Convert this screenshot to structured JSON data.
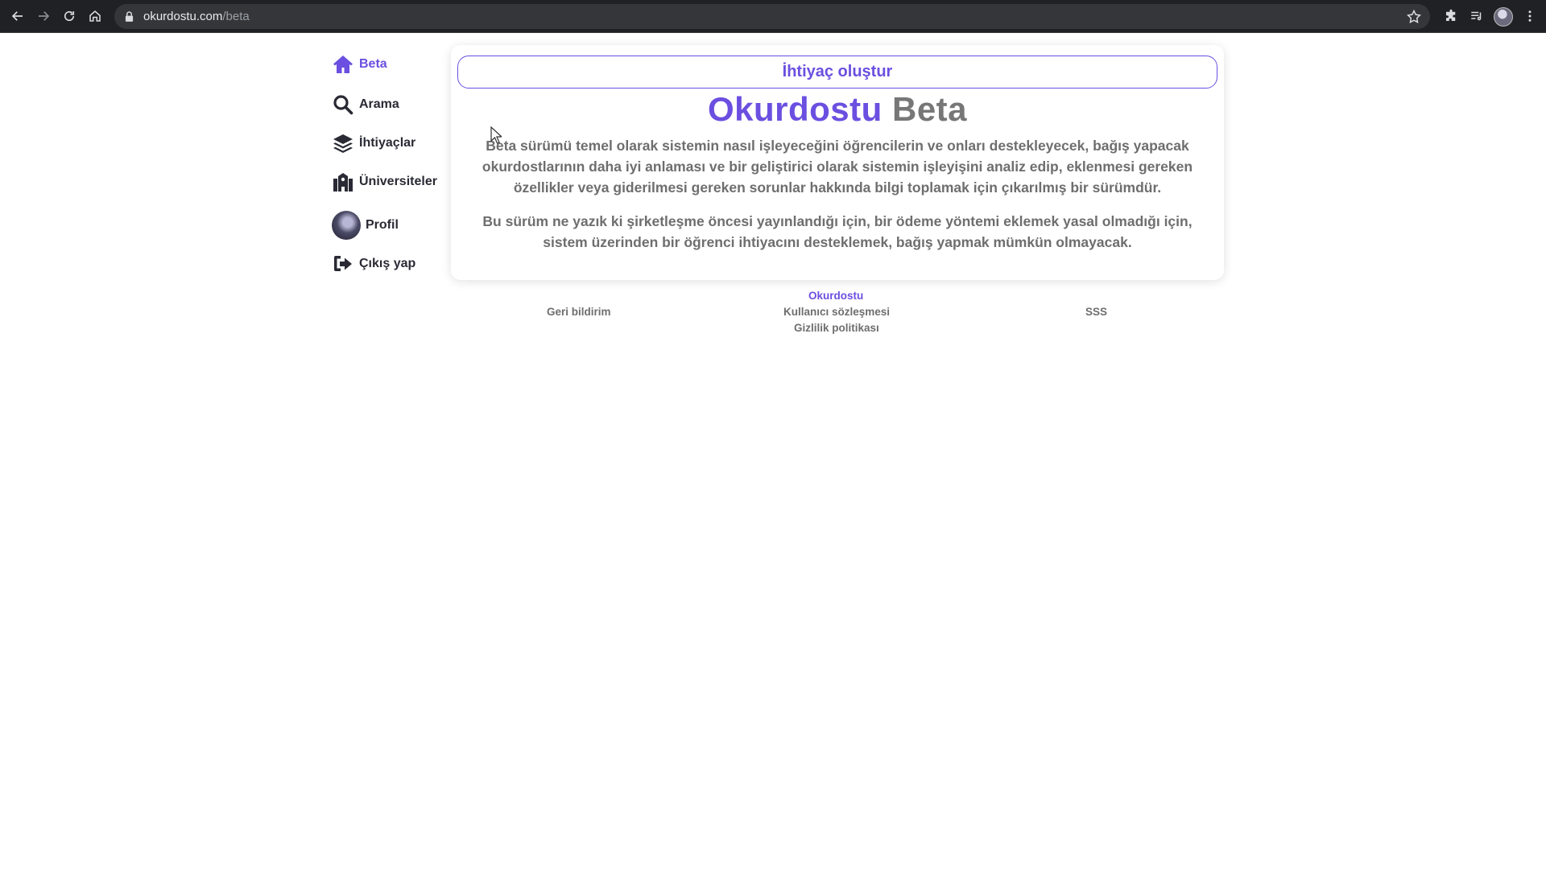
{
  "browser": {
    "url_host": "okurdostu.com",
    "url_path": "/beta"
  },
  "sidebar": {
    "items": [
      {
        "label": "Beta",
        "icon": "home-icon",
        "active": true
      },
      {
        "label": "Arama",
        "icon": "search-icon"
      },
      {
        "label": "İhtiyaçlar",
        "icon": "layers-icon"
      },
      {
        "label": "Üniversiteler",
        "icon": "university-icon"
      },
      {
        "label": "Profil",
        "icon": "avatar"
      },
      {
        "label": "Çıkış yap",
        "icon": "sign-out-icon"
      }
    ]
  },
  "main": {
    "create_button": "İhtiyaç oluştur",
    "title_brand": "Okurdostu",
    "title_suffix": "Beta",
    "paragraph1": "Beta sürümü temel olarak sistemin nasıl işleyeceğini öğrencilerin ve onları destekleyecek, bağış yapacak okurdostlarının daha iyi anlaması ve bir geliştirici olarak sistemin işleyişini analiz edip, eklenmesi gereken özellikler veya giderilmesi gereken sorunlar hakkında bilgi toplamak için çıkarılmış bir sürümdür.",
    "paragraph2": "Bu sürüm ne yazık ki şirketleşme öncesi yayınlandığı için, bir ödeme yöntemi eklemek yasal olmadığı için, sistem üzerinden bir öğrenci ihtiyacını desteklemek, bağış yapmak mümkün olmayacak."
  },
  "footer": {
    "brand": "Okurdostu",
    "feedback": "Geri bildirim",
    "terms": "Kullanıcı sözleşmesi",
    "privacy": "Gizlilik politikası",
    "faq": "SSS"
  },
  "colors": {
    "accent": "#6b4fe0",
    "text_muted": "#6e6e6e"
  }
}
